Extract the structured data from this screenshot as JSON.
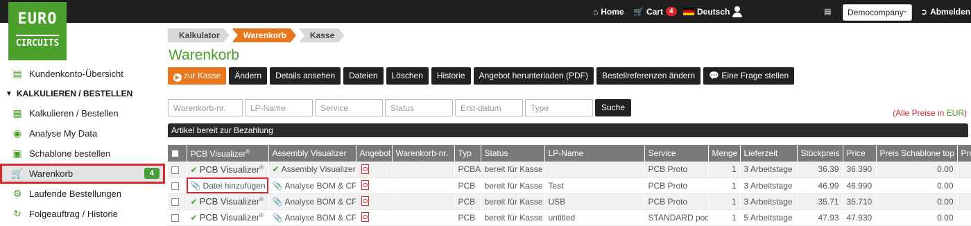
{
  "logo": {
    "line1": "EURO",
    "line2": "CIRCUITS"
  },
  "topbar": {
    "home": "Home",
    "cart": "Cart",
    "cart_count": "4",
    "language": "Deutsch",
    "company": "Democompany",
    "logout": "Abmelden"
  },
  "sidebar": {
    "account": "Kundenkonto-Übersicht",
    "section": "KALKULIEREN / BESTELLEN",
    "items": [
      {
        "label": "Kalkulieren / Bestellen"
      },
      {
        "label": "Analyse My Data"
      },
      {
        "label": "Schablone bestellen"
      },
      {
        "label": "Warenkorb",
        "badge": "4"
      },
      {
        "label": "Laufende Bestellungen"
      },
      {
        "label": "Folgeauftrag / Historie"
      }
    ]
  },
  "breadcrumb": [
    "Kalkulator",
    "Warenkorb",
    "Kasse"
  ],
  "page_title": "Warenkorb",
  "toolbar": {
    "checkout": "zur Kasse",
    "edit": "Ändern",
    "details": "Details ansehen",
    "files": "Dateien",
    "delete": "Löschen",
    "history": "Historie",
    "quote_pdf": "Angebot herunterladen (PDF)",
    "order_refs": "Bestellreferenzen ändern",
    "question": "Eine Frage stellen"
  },
  "filters": {
    "cart_no": "Warenkorb-nr.",
    "pcb_name": "LP-Name",
    "service": "Service",
    "status": "Status",
    "created": "Erst-datum",
    "type": "Type",
    "search": "Suche"
  },
  "price_note": {
    "prefix": "(Alle Preise in ",
    "currency": "EUR",
    "suffix": ")"
  },
  "section_title": "Artikel bereit zur Bezahlung",
  "table": {
    "headers": {
      "pcb_visualizer": "PCB Visualizer",
      "assembly_visualizer": "Assembly Visualizer",
      "offer": "Angebot",
      "cart_no": "Warenkorb-nr.",
      "type": "Typ",
      "status": "Status",
      "pcb_name": "LP-Name",
      "service": "Service",
      "qty": "Menge",
      "delivery": "Lieferzeit",
      "unit_price": "Stückpreis",
      "price": "Price",
      "stencil_top": "Preis Schablone top",
      "stencil_bottom": "Prei"
    },
    "reg": "®",
    "rows": [
      {
        "pcb_vis": "PCB Visualizer",
        "asm": "Assembly Visualizer",
        "asm_ok": true,
        "type": "PCBA",
        "status": "bereit für Kasse",
        "name": "",
        "service": "PCB Proto",
        "qty": "1",
        "delivery": "3 Arbeitstage",
        "unit": "36.39",
        "price": "36.390",
        "stencil": "0.00"
      },
      {
        "pcb_vis": "Datei hinzufügen",
        "asm": "Analyse BOM & CPL",
        "asm_ok": false,
        "type": "PCB",
        "status": "bereit für Kasse",
        "name": "Test",
        "service": "PCB Proto",
        "qty": "1",
        "delivery": "3 Arbeitstage",
        "unit": "46.99",
        "price": "46.990",
        "stencil": "0.00"
      },
      {
        "pcb_vis": "PCB Visualizer",
        "asm": "Analyse BOM & CPL",
        "asm_ok": false,
        "type": "PCB",
        "status": "bereit für Kasse",
        "name": "USB",
        "service": "PCB Proto",
        "qty": "1",
        "delivery": "3 Arbeitstage",
        "unit": "35.71",
        "price": "35.710",
        "stencil": "0.00"
      },
      {
        "pcb_vis": "PCB Visualizer",
        "asm": "Analyse BOM & CPL",
        "asm_ok": false,
        "type": "PCB",
        "status": "bereit für Kasse",
        "name": "untitled",
        "service": "STANDARD pool",
        "qty": "1",
        "delivery": "5 Arbeitstage",
        "unit": "47.93",
        "price": "47.930",
        "stencil": "0.00"
      }
    ]
  }
}
